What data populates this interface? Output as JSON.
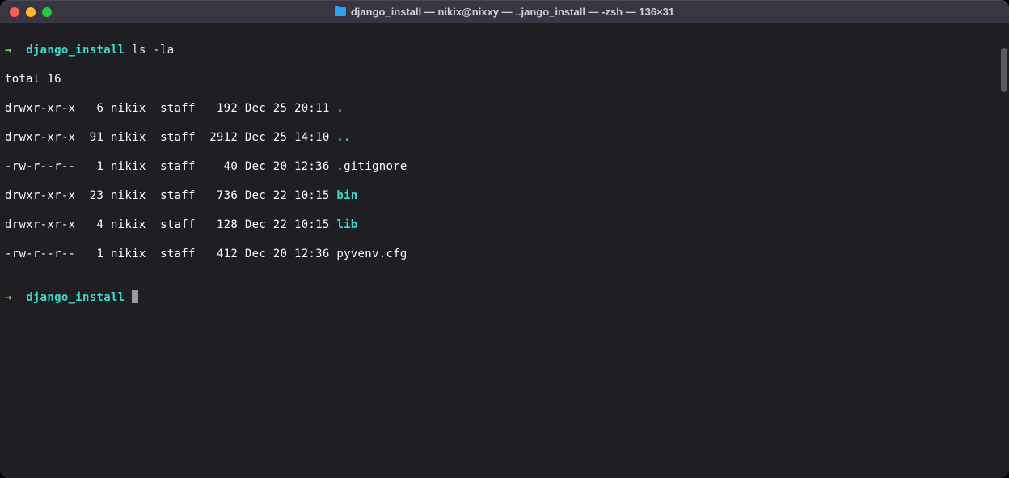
{
  "titlebar": {
    "title": "django_install — nikix@nixxy — ..jango_install — -zsh — 136×31"
  },
  "prompt": {
    "arrow": "→",
    "cwd": "django_install",
    "command": "ls -la"
  },
  "output": {
    "total": "total 16",
    "rows": [
      {
        "perm": "drwxr-xr-x",
        "links": "  6",
        "owner": "nikix",
        "group": "staff",
        "size": "  192",
        "date": "Dec 25 20:11",
        "name": ".",
        "cls": "cyan"
      },
      {
        "perm": "drwxr-xr-x",
        "links": " 91",
        "owner": "nikix",
        "group": "staff",
        "size": " 2912",
        "date": "Dec 25 14:10",
        "name": "..",
        "cls": "cyan"
      },
      {
        "perm": "-rw-r--r--",
        "links": "  1",
        "owner": "nikix",
        "group": "staff",
        "size": "   40",
        "date": "Dec 20 12:36",
        "name": ".gitignore",
        "cls": "dim"
      },
      {
        "perm": "drwxr-xr-x",
        "links": " 23",
        "owner": "nikix",
        "group": "staff",
        "size": "  736",
        "date": "Dec 22 10:15",
        "name": "bin",
        "cls": "cyan"
      },
      {
        "perm": "drwxr-xr-x",
        "links": "  4",
        "owner": "nikix",
        "group": "staff",
        "size": "  128",
        "date": "Dec 22 10:15",
        "name": "lib",
        "cls": "cyan"
      },
      {
        "perm": "-rw-r--r--",
        "links": "  1",
        "owner": "nikix",
        "group": "staff",
        "size": "  412",
        "date": "Dec 20 12:36",
        "name": "pyvenv.cfg",
        "cls": "dim"
      }
    ]
  },
  "prompt2": {
    "arrow": "→",
    "cwd": "django_install"
  }
}
